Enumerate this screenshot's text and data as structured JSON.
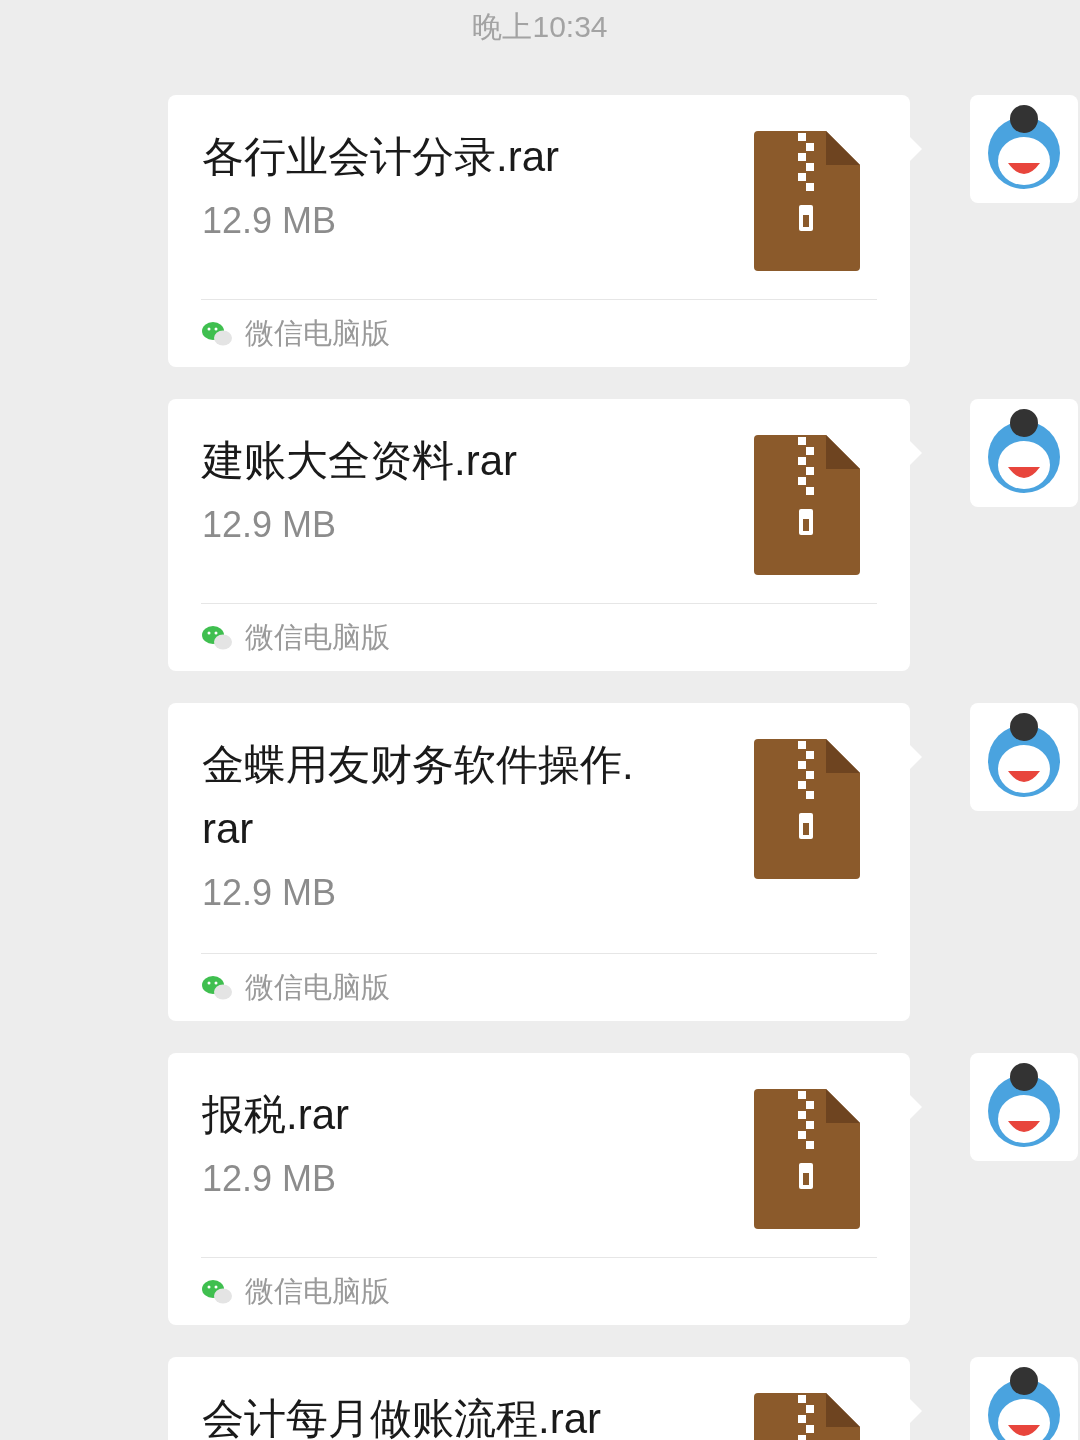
{
  "timestamp": "晚上10:34",
  "messages": [
    {
      "file_name": "各行业会计分录.rar",
      "file_size": "12.9 MB",
      "source": "微信电脑版"
    },
    {
      "file_name": "建账大全资料.rar",
      "file_size": "12.9 MB",
      "source": "微信电脑版"
    },
    {
      "file_name": "金蝶用友财务软件操作.rar",
      "file_size": "12.9 MB",
      "source": "微信电脑版"
    },
    {
      "file_name": "报税.rar",
      "file_size": "12.9 MB",
      "source": "微信电脑版"
    },
    {
      "file_name": "会计每月做账流程.rar"
    }
  ]
}
